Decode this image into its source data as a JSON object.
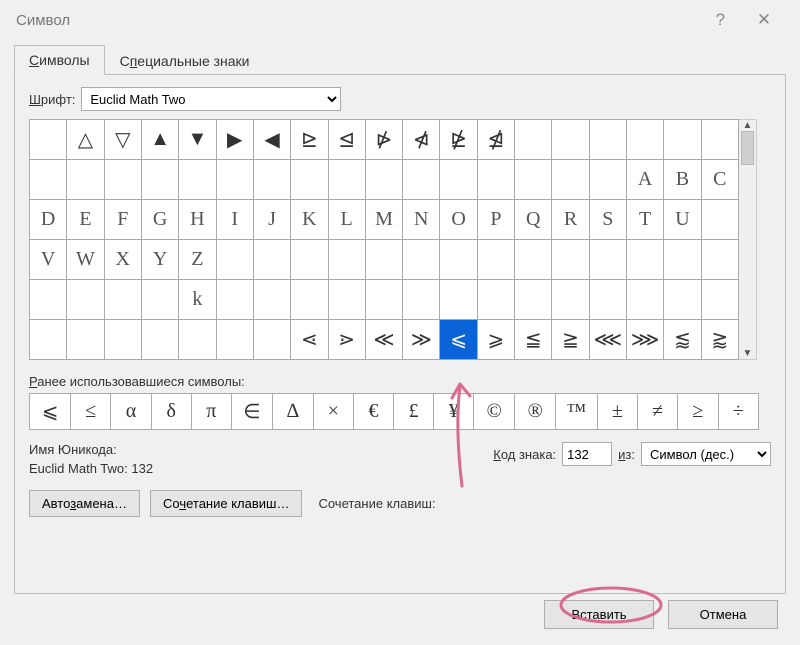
{
  "window": {
    "title": "Символ",
    "help": "?",
    "close": "✕"
  },
  "tabs": [
    {
      "label_pre": "",
      "label_u": "С",
      "label_post": "имволы",
      "active": true
    },
    {
      "label_pre": "С",
      "label_u": "п",
      "label_post": "ециальные знаки",
      "active": false
    }
  ],
  "font": {
    "label_pre": "",
    "label_u": "Ш",
    "label_post": "рифт:",
    "value": "Euclid Math Two"
  },
  "grid": {
    "cols": 19,
    "rows": [
      [
        "",
        "△",
        "▽",
        "▲",
        "▼",
        "▶",
        "◀",
        "⊵",
        "⊴",
        "⋫",
        "⋪",
        "⋭",
        "⋬",
        "",
        "",
        "",
        "",
        "",
        ""
      ],
      [
        "",
        "",
        "",
        "",
        "",
        "",
        "",
        "",
        "",
        "",
        "",
        "",
        "",
        "",
        "",
        "",
        "A",
        "B",
        "C"
      ],
      [
        "D",
        "E",
        "F",
        "G",
        "H",
        "I",
        "J",
        "K",
        "L",
        "M",
        "N",
        "O",
        "P",
        "Q",
        "R",
        "S",
        "T",
        "U"
      ],
      [
        "V",
        "W",
        "X",
        "Y",
        "Z",
        "",
        "",
        "",
        "",
        "",
        "",
        "",
        "",
        "",
        "",
        "",
        "",
        ""
      ],
      [
        "",
        "",
        "",
        "",
        "k",
        "",
        "",
        "",
        "",
        "",
        "",
        "",
        "",
        "",
        "",
        "",
        "",
        ""
      ],
      [
        "",
        "",
        "",
        "",
        "",
        "",
        "",
        "⋖",
        "⋗",
        "≪",
        "≫",
        "⩽",
        "⩾",
        "≦",
        "≧",
        "⋘",
        "⋙",
        "⪅",
        "⪆"
      ]
    ],
    "selected": {
      "row": 5,
      "col": 11
    },
    "row2_family": "outline"
  },
  "recent": {
    "label_pre": "",
    "label_u": "Р",
    "label_post": "анее использовавшиеся символы:",
    "items": [
      "⩽",
      "≤",
      "α",
      "δ",
      "π",
      "∈",
      "∆",
      "×",
      "€",
      "£",
      "¥",
      "©",
      "®",
      "™",
      "±",
      "≠",
      "≥",
      "÷"
    ]
  },
  "unicode": {
    "name_label": "Имя Юникода:",
    "name_value": "Euclid Math Two: 132",
    "code_label_pre": "",
    "code_label_u": "К",
    "code_label_post": "од знака:",
    "code_value": "132",
    "from_label_pre": "",
    "from_label_u": "и",
    "from_label_post": "з:",
    "from_value": "Символ (дес.)"
  },
  "buttons": {
    "autocorrect_pre": "Авто",
    "autocorrect_u": "з",
    "autocorrect_post": "амена…",
    "shortcut_pre": "Со",
    "shortcut_u": "ч",
    "shortcut_post": "етание клавиш…",
    "shortcut_hint": "Сочетание клавиш:",
    "insert_pre": "Вст",
    "insert_u": "а",
    "insert_post": "вить",
    "cancel": "Отмена"
  },
  "annotation": {
    "color": "#d96b8f"
  }
}
